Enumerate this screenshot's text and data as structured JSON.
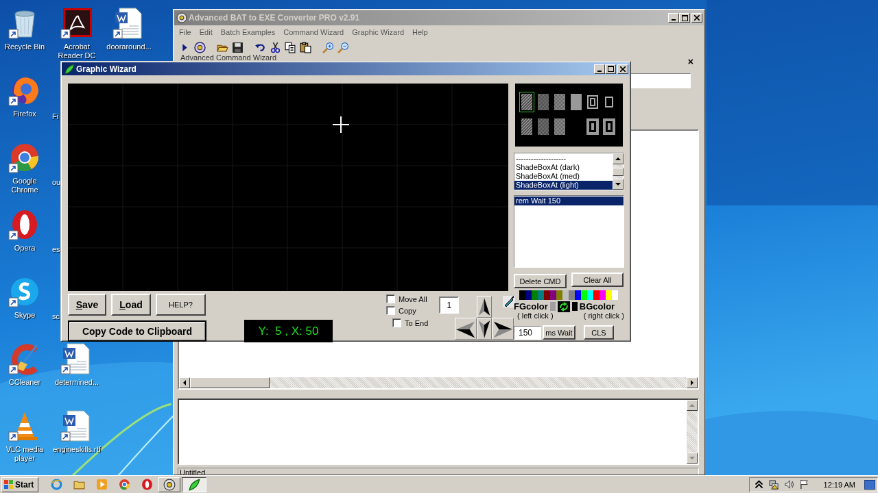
{
  "desktop_icons": [
    {
      "label": "Recycle Bin",
      "kind": "trash"
    },
    {
      "label": "Firefox",
      "kind": "fox"
    },
    {
      "label": "Google Chrome",
      "kind": "wheel"
    },
    {
      "label": "Opera",
      "kind": "ring"
    },
    {
      "label": "Skype",
      "kind": "cloud"
    },
    {
      "label": "CCleaner",
      "kind": "broom"
    },
    {
      "label": "VLC media player",
      "kind": "cone"
    },
    {
      "label": "Acrobat Reader DC",
      "kind": "reader"
    },
    {
      "label": "Fi",
      "kind": "hidden"
    },
    {
      "label": "ou",
      "kind": "hidden"
    },
    {
      "label": "es",
      "kind": "hidden"
    },
    {
      "label": "sc",
      "kind": "hidden"
    },
    {
      "label": "determined...",
      "kind": "document"
    },
    {
      "label": "engineskills.rtf",
      "kind": "document"
    },
    {
      "label": "dooraround...",
      "kind": "document"
    }
  ],
  "main_window": {
    "title": "Advanced BAT to EXE Converter PRO v2.91",
    "menu": [
      "File",
      "Edit",
      "Batch Examples",
      "Command Wizard",
      "Graphic Wizard",
      "Help"
    ],
    "group_label": "Advanced Command Wizard",
    "panel_close": "×",
    "status_bar": "Untitled"
  },
  "wizard": {
    "title": "Graphic Wizard",
    "patterns": [
      {
        "kind": "hatch",
        "selected": true
      },
      {
        "kind": "cross",
        "selected": false
      },
      {
        "kind": "checker",
        "selected": false
      },
      {
        "kind": "solid",
        "selected": false
      },
      {
        "kind": "frame",
        "selected": false
      },
      {
        "kind": "outline",
        "selected": false
      },
      {
        "kind": "hatch",
        "selected": false
      },
      {
        "kind": "cross",
        "selected": false
      },
      {
        "kind": "checker",
        "selected": false
      },
      {
        "kind": "boxed",
        "selected": false
      },
      {
        "kind": "boxed",
        "selected": false
      }
    ],
    "commands": [
      {
        "label": "--------------------",
        "selected": false
      },
      {
        "label": "ShadeBoxAt (dark)",
        "selected": false
      },
      {
        "label": "ShadeBoxAt (med)",
        "selected": false
      },
      {
        "label": "ShadeBoxAt (light)",
        "selected": true
      }
    ],
    "script_lines": [
      {
        "label": "rem Wait 150",
        "selected": true
      }
    ],
    "delete_button": "Delete CMD",
    "clear_button": "Clear All",
    "palette": [
      {
        "color": "#000000"
      },
      {
        "color": "#000080"
      },
      {
        "color": "#008000"
      },
      {
        "color": "#008080"
      },
      {
        "color": "#800000"
      },
      {
        "color": "#800080"
      },
      {
        "color": "#808000"
      },
      {
        "color": "#c0c0c0"
      },
      {
        "color": "#808080"
      },
      {
        "color": "#0000ff"
      },
      {
        "color": "#00ff00"
      },
      {
        "color": "#00ffff"
      },
      {
        "color": "#ff0000"
      },
      {
        "color": "#ff00ff"
      },
      {
        "color": "#ffff00"
      },
      {
        "color": "#ffffff"
      }
    ],
    "fg_label": "FGcolor",
    "fg_hint": "( left click )",
    "bg_label": "BGcolor",
    "bg_hint": "( right click )",
    "current_colors": [
      {
        "color": "#a0a0a0"
      },
      {
        "color": "#000000"
      }
    ],
    "wait_value": "150",
    "wait_button": "ms Wait",
    "cls_button": "CLS",
    "save_button": "Save",
    "load_button": "Load",
    "help_button": "HELP?",
    "copy_button": "Copy Code to Clipboard",
    "position": "Y:  5 , X: 50",
    "checkboxes": [
      {
        "label": "Move All",
        "checked": false
      },
      {
        "label": "Copy",
        "checked": false
      },
      {
        "label": "To End",
        "checked": false
      }
    ],
    "step": "1"
  },
  "taskbar": {
    "start": "Start",
    "windows": [
      {
        "selected": false
      },
      {
        "selected": true
      }
    ],
    "clock": "12:19 AM"
  }
}
